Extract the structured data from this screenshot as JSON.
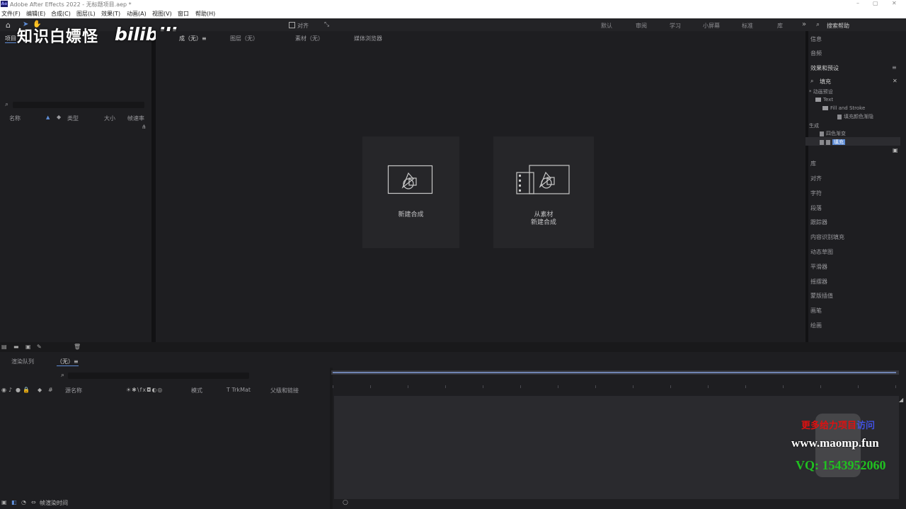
{
  "window": {
    "app_title": "Adobe After Effects 2022",
    "project_name": "无标题项目.aep *",
    "app_logo": "Ae"
  },
  "menu": [
    "文件(F)",
    "编辑(E)",
    "合成(C)",
    "图层(L)",
    "效果(T)",
    "动画(A)",
    "视图(V)",
    "窗口",
    "帮助(H)"
  ],
  "toolbar": {
    "snap_label": "对齐",
    "workspaces": [
      "默认",
      "审阅",
      "学习",
      "小屏幕",
      "标准",
      "库"
    ],
    "search_help": "搜索帮助"
  },
  "watermark": {
    "text": "知识白嫖怪",
    "logo": "bilibili"
  },
  "project_panel": {
    "tab": "项目",
    "columns": {
      "name": "名称",
      "type": "类型",
      "size": "大小",
      "fps": "帧速率"
    }
  },
  "viewer_tabs": [
    "成（无）≡",
    "图层（无）",
    "素材（无）",
    "媒体浏览器"
  ],
  "start_cards": {
    "new_comp": "新建合成",
    "from_footage_line1": "从素材",
    "from_footage_line2": "新建合成"
  },
  "right_panel": {
    "top_items": [
      "信息",
      "音频"
    ],
    "effects_title": "效果和预设",
    "search_value": "填充",
    "tree": {
      "animation_presets": "* 动画预设",
      "text": "Text",
      "fill_and_stroke": "Fill and Stroke",
      "preset_item": "填充颜色渐隐",
      "generate": "生成",
      "gradient_fill": "四色渐变",
      "fill": "填充"
    },
    "panel_items": [
      "库",
      "对齐",
      "字符",
      "段落",
      "跟踪器",
      "内容识别填充",
      "动态草图",
      "平滑器",
      "摇摆器",
      "蒙版插值",
      "画笔",
      "绘画"
    ]
  },
  "timeline": {
    "tabs": [
      "渲染队列",
      "（无）≡"
    ],
    "columns": {
      "source_name": "源名称",
      "mode": "模式",
      "trkmat": "T TrkMat",
      "parent": "父级和链接"
    },
    "footer": "帧渲染时间"
  },
  "ad": {
    "line1_red": "更多给力项目",
    "line1_blue": "访问",
    "line2": "www.maomp.fun",
    "line3": "VQ: 1543952060"
  },
  "colors": {
    "accent": "#5f8dd6",
    "panel": "#1e1e21",
    "ad_red": "#e01010",
    "ad_green": "#20c020"
  }
}
